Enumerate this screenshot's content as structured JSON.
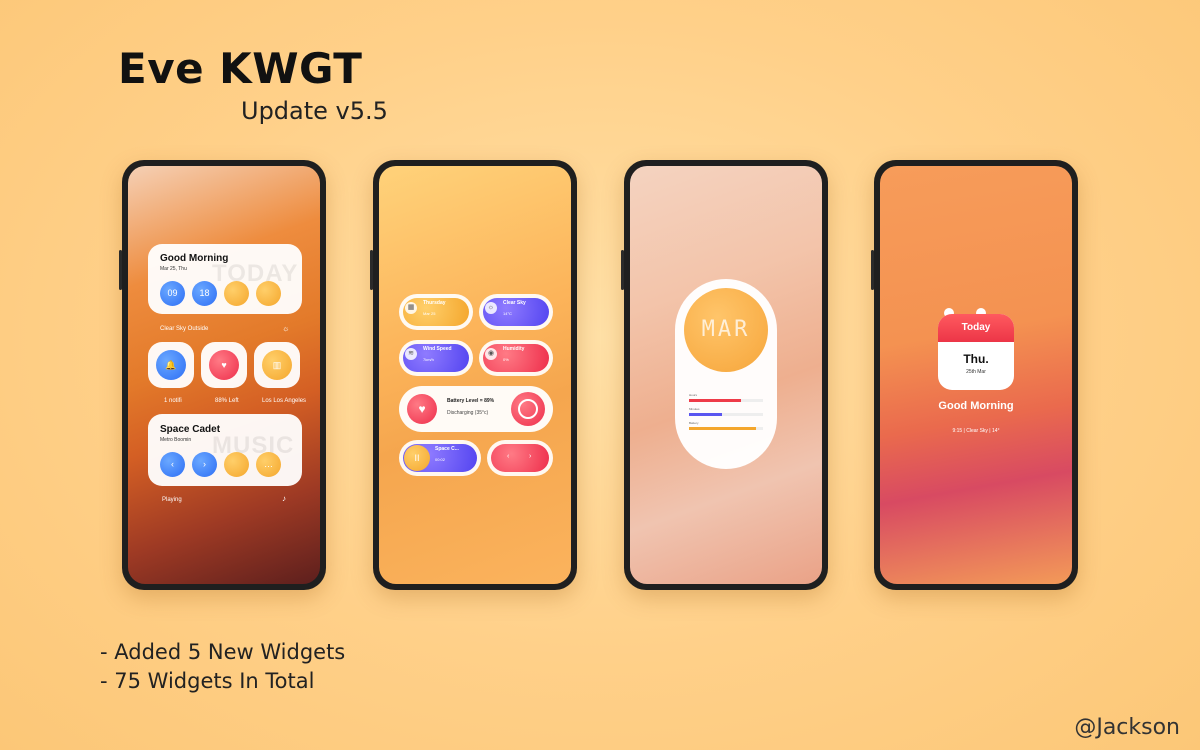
{
  "header": {
    "title": "Eve KWGT",
    "subtitle": "Update v5.5"
  },
  "notes": [
    "- Added 5 New Widgets",
    "- 75 Widgets In Total"
  ],
  "credit": "@Jackson",
  "phone1": {
    "greeting": "Good Morning",
    "date": "Mar 25, Thu",
    "watermark_today": "TODAY",
    "circle1": "09",
    "circle2": "18",
    "weather_text": "Clear Sky Outside",
    "tile_labels": [
      "1 notifi",
      "88% Left",
      "Los Los Angeles"
    ],
    "music_title": "Space Cadet",
    "music_artist": "Metro Boomin",
    "watermark_music": "MUSIC",
    "playing": "Playing"
  },
  "phone2": {
    "day": "Thursday",
    "day_sub": "Mar 25",
    "sky": "Clear Sky",
    "sky_sub": "14°C",
    "wind": "Wind Speed",
    "wind_sub": "7km/h",
    "humidity": "Humidity",
    "humidity_sub": "0%",
    "battery": "Battery Level = 89%",
    "discharging": "Discharging (35°c)",
    "song": "Space C...",
    "song_sub": "00:02"
  },
  "phone3": {
    "clock_text": "MAR",
    "bars": [
      {
        "label": "Hours",
        "fill": 0.7,
        "color": "#ee3b48"
      },
      {
        "label": "Minutes",
        "fill": 0.45,
        "color": "#5a56f0"
      },
      {
        "label": "Battery",
        "fill": 0.9,
        "color": "#f4a62c"
      }
    ]
  },
  "phone4": {
    "cal_header": "Today",
    "day": "Thu.",
    "date": "25th Mar",
    "greeting": "Good Morning",
    "footer": "9:15  |  Clear Sky  |  14°"
  },
  "colors": {
    "background": "#ffd38e",
    "accent_orange": "#f4a62c",
    "accent_red": "#ee2e4b",
    "accent_blue": "#2d6ef5"
  }
}
